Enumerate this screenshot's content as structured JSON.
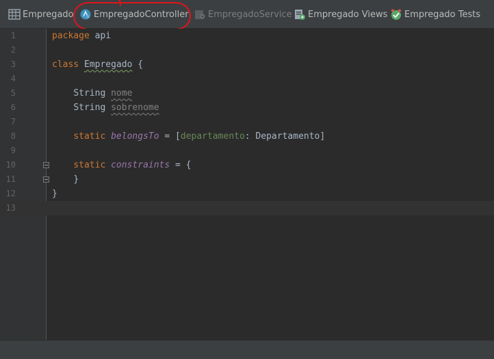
{
  "navbar": {
    "items": [
      {
        "label": "Empregado",
        "icon": "table-icon",
        "dimmed": false
      },
      {
        "label": "EmpregadoController",
        "icon": "controller-icon",
        "dimmed": false
      },
      {
        "label": "EmpregadoService",
        "icon": "service-icon",
        "dimmed": true
      },
      {
        "label": "Empregado Views",
        "icon": "views-icon",
        "dimmed": false
      },
      {
        "label": "Empregado Tests",
        "icon": "tests-icon",
        "dimmed": false
      }
    ],
    "highlighted": "EmpregadoController"
  },
  "editor": {
    "line_numbers": [
      "1",
      "2",
      "3",
      "4",
      "5",
      "6",
      "7",
      "8",
      "9",
      "10",
      "11",
      "12",
      "13"
    ],
    "current_line": 13,
    "code": {
      "l1_kw": "package",
      "l1_rest": " api",
      "l3_kw": "class",
      "l3_name": "Empregado",
      "l3_rest": " {",
      "l5_type": "String",
      "l5_field": "nome",
      "l6_type": "String",
      "l6_field": "sobrenome",
      "l8_kw": "static",
      "l8_field": "belongsTo",
      "l8_op": " = [",
      "l8_key": "departamento",
      "l8_colon": ": ",
      "l8_val": "Departamento",
      "l8_end": "]",
      "l10_kw": "static",
      "l10_field": "constraints",
      "l10_rest": " = {",
      "l11": "}",
      "l12": "}"
    }
  },
  "colors": {
    "keyword": "#cc7832",
    "field": "#9876aa",
    "text": "#a9b7c6",
    "named_arg": "#6a8759",
    "annotation_ring": "#e0141a"
  }
}
